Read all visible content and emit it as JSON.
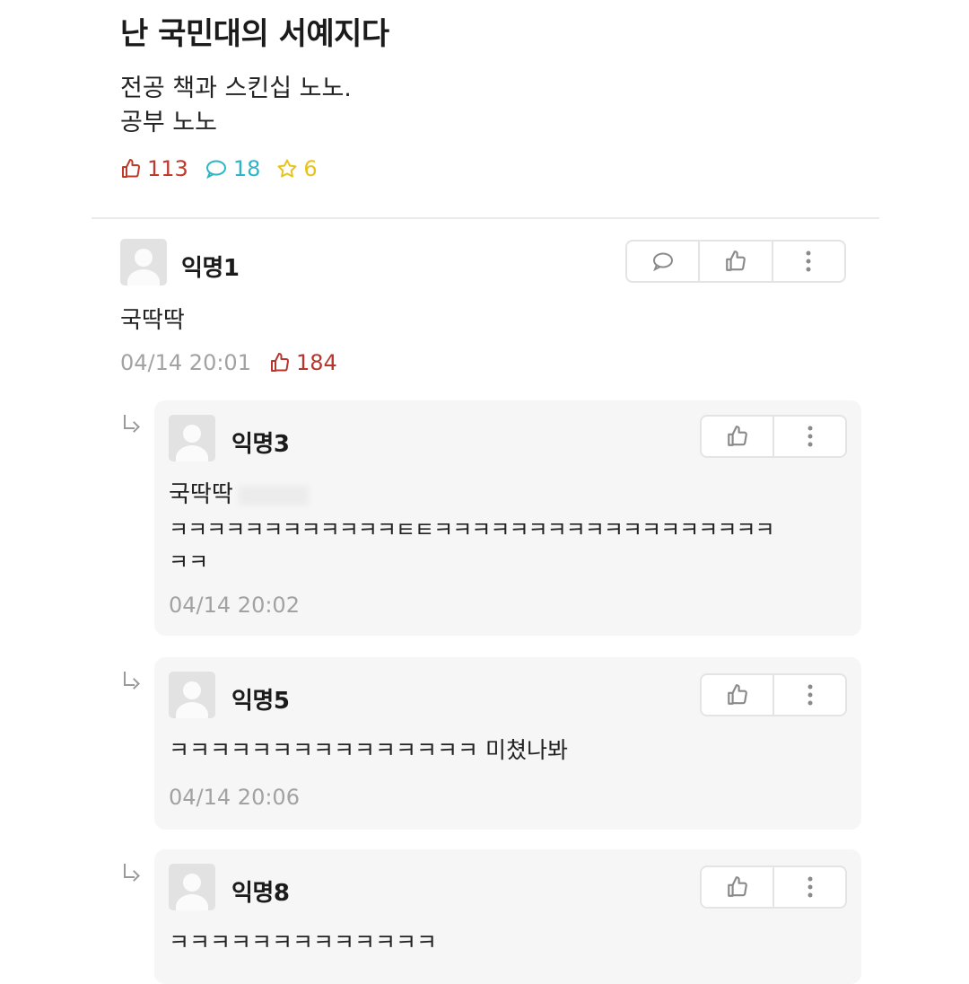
{
  "post": {
    "title": "난 국민대의 서예지다",
    "body_lines": [
      "전공 책과 스킨십 노노.",
      "공부 노노"
    ],
    "stats": {
      "likes": "113",
      "comments": "18",
      "scraps": "6"
    },
    "colors": {
      "like": "#c0392b",
      "comment": "#2bb5c9",
      "scrap": "#e8c21d"
    }
  },
  "comments": [
    {
      "author": "익명1",
      "text": "국딱딱",
      "time": "04/14 20:01",
      "likes": "184"
    }
  ],
  "replies": [
    {
      "author": "익명3",
      "text_lines": [
        "국딱딱",
        "ㅋㅋㅋㅋㅋㅋㅋㅋㅋㅋㅋㅋㅌㅌㅋㅋㅋㅋㅋㅋㅋㅋㅋㅋㅋㅋㅋㅋㅋㅋㅋㅋ",
        "ㅋㅋ"
      ],
      "time": "04/14 20:02"
    },
    {
      "author": "익명5",
      "text_lines": [
        "ㅋㅋㅋㅋㅋㅋㅋㅋㅋㅋㅋㅋㅋㅋㅋ 미쳤나봐"
      ],
      "time": "04/14 20:06"
    },
    {
      "author": "익명8",
      "text_lines": [
        "ㅋㅋㅋㅋㅋㅋㅋㅋㅋㅋㅋㅋㅋ"
      ]
    }
  ],
  "icons": {
    "like": "thumbs-up-icon",
    "comment": "speech-bubble-icon",
    "scrap": "star-icon",
    "more": "more-vertical-icon",
    "reply": "reply-arrow-icon",
    "avatar": "default-avatar-icon"
  }
}
